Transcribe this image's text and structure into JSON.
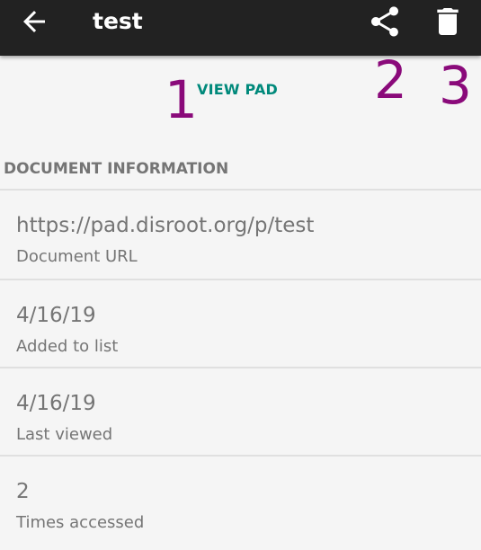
{
  "appbar": {
    "title": "test",
    "back_icon": "arrow-left-icon",
    "share_icon": "share-icon",
    "delete_icon": "trash-icon"
  },
  "annotations": [
    "1",
    "2",
    "3"
  ],
  "actions": {
    "view_pad_label": "VIEW PAD"
  },
  "document_info": {
    "header": "DOCUMENT INFORMATION",
    "items": [
      {
        "value": "https://pad.disroot.org/p/test",
        "label": "Document URL"
      },
      {
        "value": "4/16/19",
        "label": "Added to list"
      },
      {
        "value": "4/16/19",
        "label": "Last viewed"
      },
      {
        "value": "2",
        "label": "Times accessed"
      }
    ]
  },
  "colors": {
    "appbar": "#222222",
    "accent": "#00897b",
    "annotation": "#8a0a7a",
    "text_secondary": "#757575",
    "background": "#f5f5f5"
  }
}
